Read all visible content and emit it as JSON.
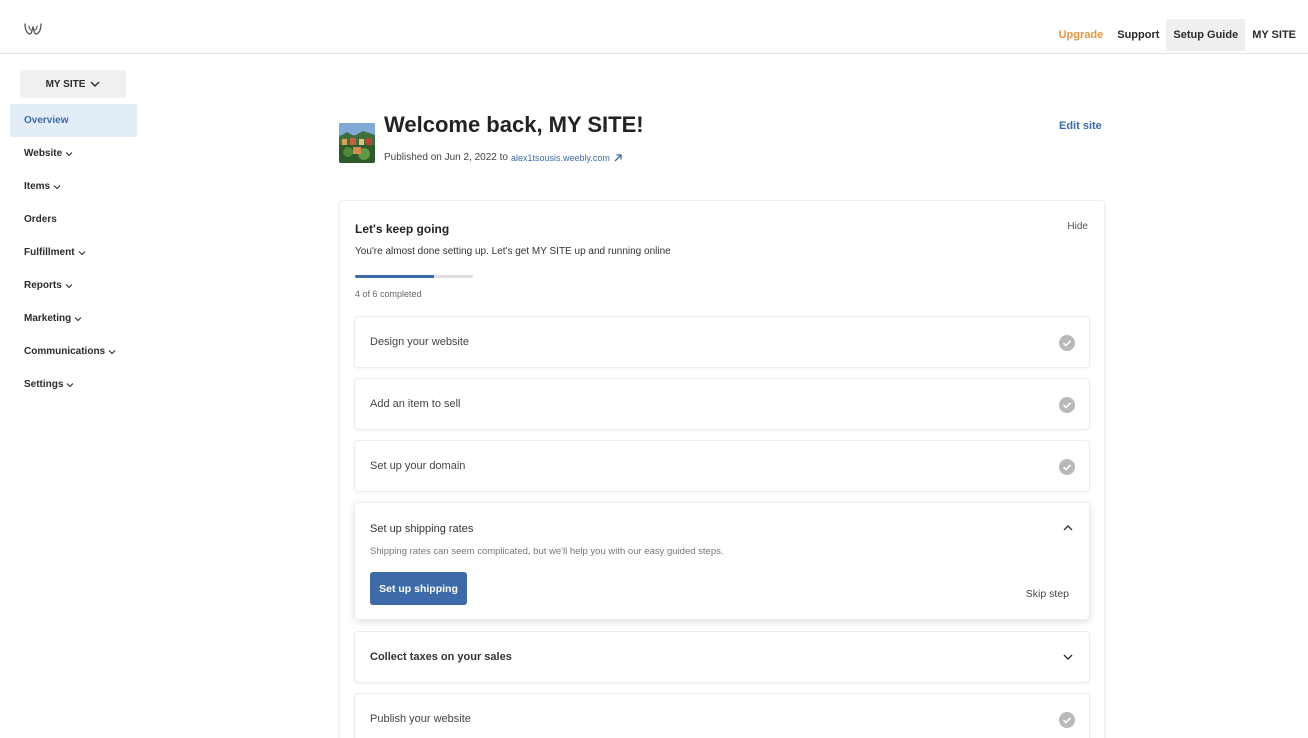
{
  "topnav": {
    "upgrade": "Upgrade",
    "support": "Support",
    "setup_guide": "Setup Guide",
    "my_site": "MY SITE"
  },
  "sidebar": {
    "site_selector": "MY SITE",
    "items": [
      {
        "label": "Overview",
        "has_menu": false,
        "active": true
      },
      {
        "label": "Website",
        "has_menu": true
      },
      {
        "label": "Items",
        "has_menu": true
      },
      {
        "label": "Orders",
        "has_menu": false
      },
      {
        "label": "Fulfillment",
        "has_menu": true
      },
      {
        "label": "Reports",
        "has_menu": true
      },
      {
        "label": "Marketing",
        "has_menu": true
      },
      {
        "label": "Communications",
        "has_menu": true
      },
      {
        "label": "Settings",
        "has_menu": true
      }
    ]
  },
  "header": {
    "title": "Welcome back, MY SITE!",
    "published_prefix": "Published on Jun 2, 2022 to",
    "site_url": "alex1tsousis.weebly.com",
    "edit_site": "Edit site"
  },
  "setup": {
    "title": "Let's keep going",
    "hide": "Hide",
    "subtitle": "You're almost done setting up. Let's get MY SITE up and running online",
    "progress_completed": 4,
    "progress_total": 6,
    "progress_label": "4 of 6 completed",
    "steps": [
      {
        "label": "Design your website",
        "state": "done"
      },
      {
        "label": "Add an item to sell",
        "state": "done"
      },
      {
        "label": "Set up your domain",
        "state": "done"
      },
      {
        "label": "Set up shipping rates",
        "state": "expanded",
        "description": "Shipping rates can seem complicated, but we'll help you with our easy guided steps.",
        "button": "Set up shipping",
        "skip": "Skip step"
      },
      {
        "label": "Collect taxes on your sales",
        "state": "collapsed"
      },
      {
        "label": "Publish your website",
        "state": "done"
      }
    ]
  },
  "colors": {
    "accent": "#3d6aa8",
    "upgrade": "#e8963b",
    "check": "#b9b9b9"
  }
}
